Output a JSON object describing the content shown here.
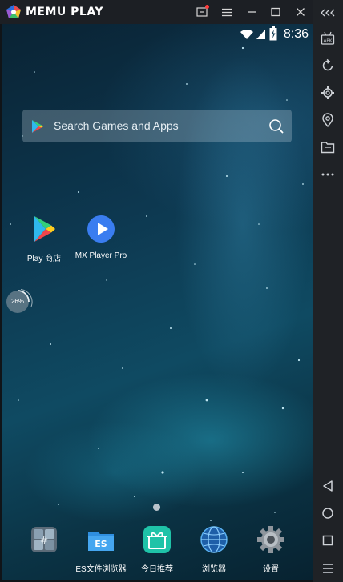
{
  "titlebar": {
    "brand": "MEMU PLAY",
    "buttons": [
      "screenshot-icon",
      "menu-icon",
      "minimize-icon",
      "maximize-icon",
      "close-icon"
    ]
  },
  "sidebar": {
    "buttons": [
      "collapse-icon",
      "apk-install-icon",
      "rotate-icon",
      "settings-icon",
      "location-icon",
      "folder-icon",
      "more-icon",
      "back-icon",
      "home-icon",
      "recents-icon",
      "list-icon"
    ]
  },
  "status": {
    "time": "8:36"
  },
  "search": {
    "placeholder": "Search Games and Apps"
  },
  "apps": [
    {
      "label": "Play 商店",
      "icon": "play-store-icon"
    },
    {
      "label": "MX Player Pro",
      "icon": "mx-player-icon"
    }
  ],
  "widget": {
    "percent": "26%"
  },
  "dock": [
    {
      "label": "",
      "icon": "tools-icon"
    },
    {
      "label": "ES文件浏览器",
      "icon": "es-file-explorer-icon"
    },
    {
      "label": "今日推荐",
      "icon": "gift-icon"
    },
    {
      "label": "浏览器",
      "icon": "browser-icon"
    },
    {
      "label": "设置",
      "icon": "settings-gear-icon"
    }
  ]
}
